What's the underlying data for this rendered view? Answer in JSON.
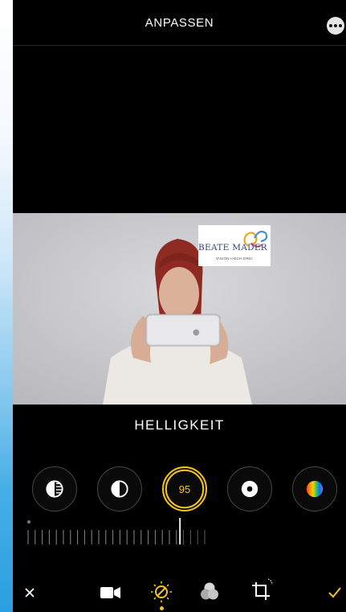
{
  "header": {
    "title": "ANPASSEN"
  },
  "photo": {
    "logo_name": "BEATE MADER",
    "logo_tagline": "VISION HOCH DREI",
    "caption": "Beate Mader"
  },
  "adjust": {
    "tool_label": "HELLIGKEIT",
    "active_value": "95",
    "slider_level": 0.95
  },
  "colors": {
    "accent": "#f5c518",
    "background": "#000000"
  },
  "tools": [
    "exposure-icon",
    "brilliance-icon",
    "brightness-active",
    "highlights-icon",
    "color-icon"
  ],
  "bottom_modes": [
    "video-icon",
    "adjust-icon",
    "filters-icon",
    "crop-icon"
  ]
}
